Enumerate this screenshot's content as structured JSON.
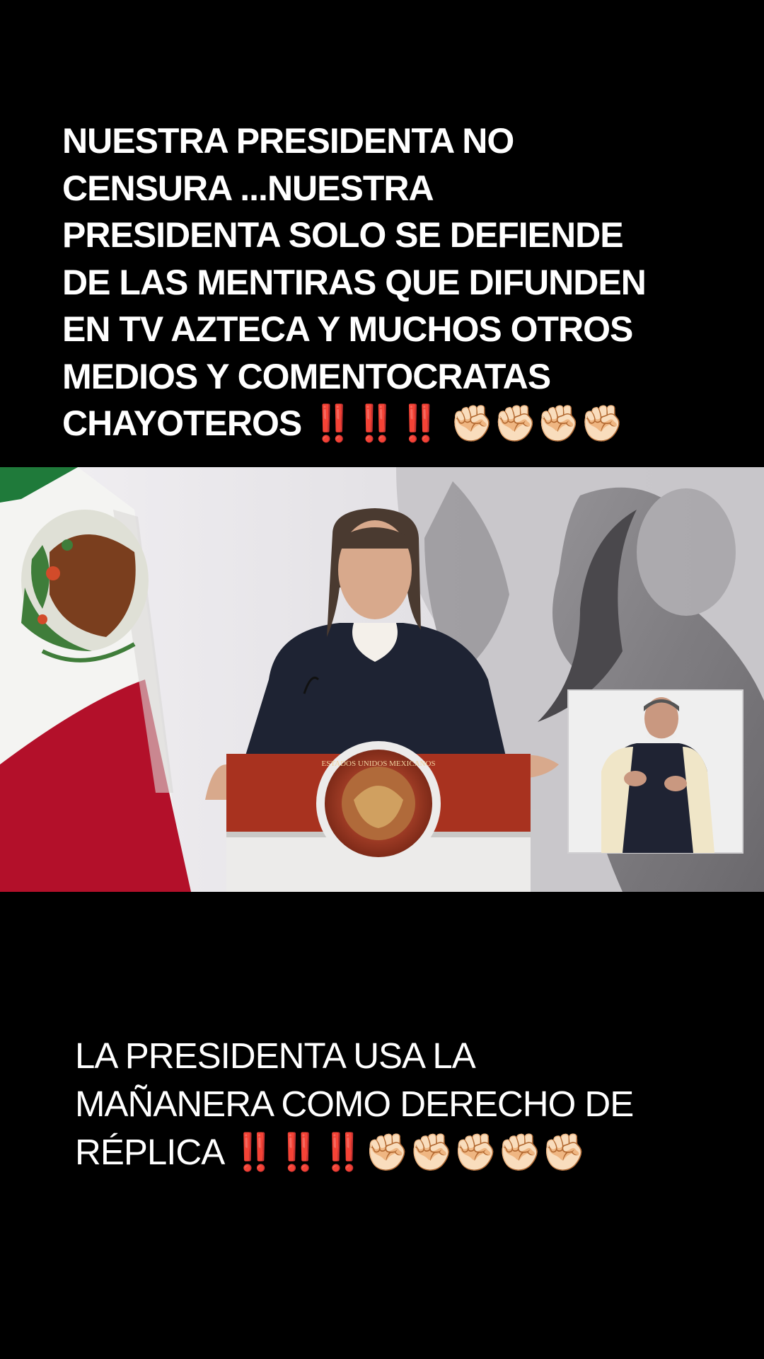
{
  "caption_top": {
    "lines": [
      "NUESTRA PRESIDENTA NO",
      "CENSURA ...NUESTRA",
      "PRESIDENTA SOLO SE DEFIENDE",
      "DE LAS MENTIRAS QUE DIFUNDEN",
      "EN TV AZTECA Y MUCHOS OTROS",
      "MEDIOS Y COMENTOCRATAS",
      "CHAYOTEROS"
    ],
    "bangs": "‼️‼️‼️",
    "fists": "✊🏻✊🏻✊🏻✊🏻"
  },
  "caption_bottom": {
    "lines": [
      "LA PRESIDENTA USA LA",
      "MAÑANERA COMO DERECHO DE",
      "RÉPLICA"
    ],
    "bangs": "‼️‼️‼️",
    "fists": "✊🏻✊🏻✊🏻✊🏻✊🏻"
  },
  "video_frame": {
    "podium_seal_text": "ESTADOS UNIDOS MEXICANOS",
    "colors": {
      "flag_green": "#1f7a3a",
      "flag_white": "#f4f4f2",
      "flag_red": "#b3102a",
      "podium_red": "#a8321f",
      "backdrop": "#e6e4e7"
    }
  }
}
